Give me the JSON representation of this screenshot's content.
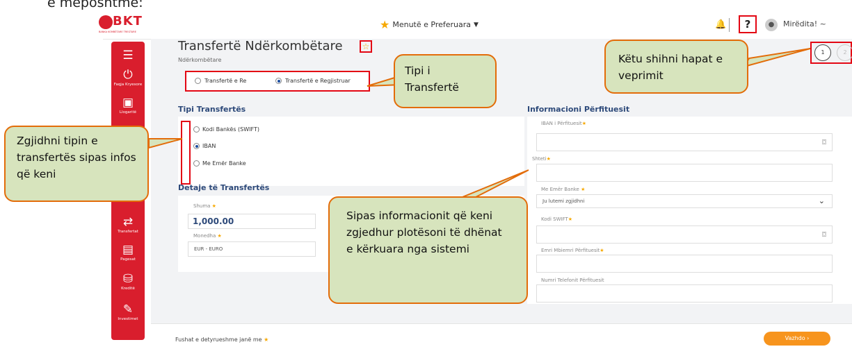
{
  "caption_top": "e mëposhtme:",
  "header": {
    "logo_text": "BKT",
    "logo_subtext": "BANKA KOMBËTARE TREGTARE",
    "favorites_label": "Menutë e Preferuara",
    "help_label": "?",
    "greeting": "Mirëdita! ~"
  },
  "sidebar": {
    "items": [
      {
        "icon": "menu-icon",
        "label": ""
      },
      {
        "icon": "power-icon",
        "label": "Faqja Kryesore"
      },
      {
        "icon": "accounts-icon",
        "label": "Llogaritë"
      },
      {
        "icon": "transfer-icon",
        "label": "Transfertat"
      },
      {
        "icon": "payments-icon",
        "label": "Pagesat"
      },
      {
        "icon": "credit-icon",
        "label": "Kreditë"
      },
      {
        "icon": "investment-icon",
        "label": "Investimet"
      }
    ]
  },
  "page": {
    "title": "Transfertë Ndërkombëtare",
    "subtitle": "Ndërkombëtare",
    "transfer_options": [
      "Transfertë e Re",
      "Transfertë e Regjistruar"
    ],
    "selected_option": "Transfertë e Regjistruar",
    "steps": [
      "1",
      "2"
    ]
  },
  "transfer_type": {
    "heading": "Tipi Transfertës",
    "options": [
      "Kodi Bankës (SWIFT)",
      "IBAN",
      "Me Emër Banke"
    ],
    "selected": "IBAN"
  },
  "details": {
    "heading": "Detaje të Transfertës",
    "amount_label": "Shuma",
    "amount_value": "1,000.00",
    "currency_label": "Monedha",
    "currency_value": "EUR - EURO"
  },
  "beneficiary": {
    "heading": "Informacioni Përfituesit",
    "fields": [
      {
        "label": "IBAN i Përfituesit",
        "required": true,
        "value": "",
        "camera": true
      },
      {
        "label": "Shteti",
        "required": true,
        "value": "",
        "camera": false
      },
      {
        "label": "Me Emër Banke",
        "required": true,
        "value": "Ju lutemi zgjidhni",
        "dropdown": true
      },
      {
        "label": "Kodi SWIFT",
        "required": true,
        "value": "",
        "camera": true
      },
      {
        "label": "Emri Mbiemri Përfituesit",
        "required": true,
        "value": ""
      },
      {
        "label": "Numri Telefonit Përfituesit",
        "required": false,
        "value": ""
      }
    ]
  },
  "footer": {
    "required_note": "Fushat e detyrueshme janë me",
    "continue_label": "Vazhdo  ›"
  },
  "callouts": {
    "tipi": "Tipi i Transfertë",
    "hapat": "Këtu shihni hapat e veprimit",
    "zgjidhni": "Zgjidhni tipin e transfertës sipas infos që keni",
    "sipas": "Sipas informacionit që keni zgjedhur plotësoni të dhënat e kërkuara nga sistemi"
  },
  "colors": {
    "brand_red": "#d91e2d",
    "accent_orange": "#f7941d",
    "callout_fill": "#d7e4bd",
    "callout_border": "#e36c09",
    "heading_blue": "#2e4a7a"
  }
}
